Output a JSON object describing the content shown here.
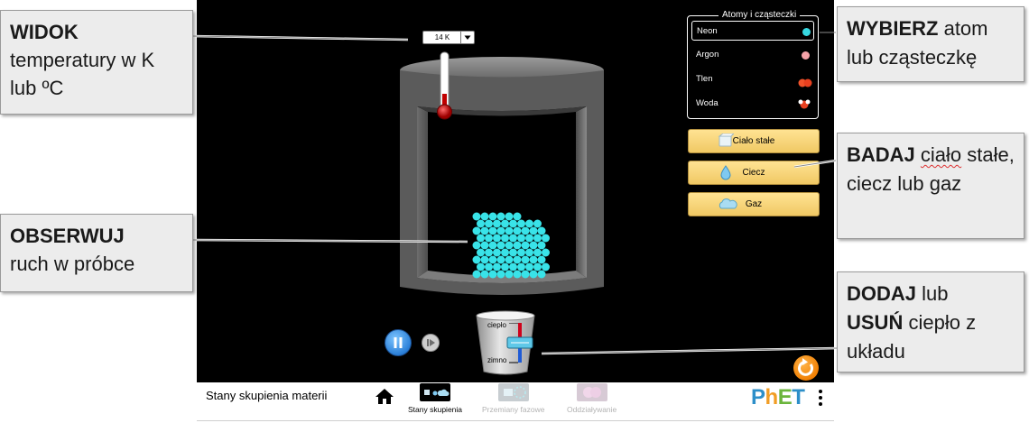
{
  "callouts": {
    "view": {
      "bold": "WIDOK",
      "text": "temperatury w K lub ºC"
    },
    "observe": {
      "bold": "OBSERWUJ",
      "text": "ruch w próbce"
    },
    "select": {
      "bold": "WYBIERZ",
      "text": "atom lub cząsteczkę"
    },
    "explore": {
      "bold": "BADAJ",
      "text": "ciało stałe, ciecz lub gaz"
    },
    "add": {
      "bold1": "DODAJ",
      "mid": "lub",
      "bold2": "USUŃ",
      "text": "ciepło z układu"
    }
  },
  "sim": {
    "atoms_panel": {
      "title": "Atomy i cząsteczki",
      "items": [
        {
          "label": "Neon",
          "color": "#36d7e0",
          "selected": true
        },
        {
          "label": "Argon",
          "color": "#f5a2a8",
          "selected": false
        },
        {
          "label": "Tlen",
          "color": "#f0522a",
          "selected": false
        },
        {
          "label": "Woda",
          "color": "#e8401f",
          "selected": false
        }
      ]
    },
    "phase_buttons": [
      {
        "label": "Ciało stałe",
        "icon": "ice-cube-icon"
      },
      {
        "label": "Ciecz",
        "icon": "water-drop-icon"
      },
      {
        "label": "Gaz",
        "icon": "cloud-icon"
      }
    ],
    "thermometer": {
      "value": "14 K"
    },
    "heater": {
      "hot_label": "ciepło",
      "cold_label": "zimno"
    },
    "particle_color": "#39e3e8"
  },
  "navbar": {
    "title": "Stany skupienia materii",
    "screens": [
      {
        "label": "Stany skupienia",
        "active": true
      },
      {
        "label": "Przemiany fazowe",
        "active": false
      },
      {
        "label": "Oddziaływanie",
        "active": false
      }
    ],
    "logo": "PhET"
  },
  "colors": {
    "background": "#000000",
    "phase_button": "#f5d67a",
    "pause_button": "#2a7fd8",
    "reset_button": "#f07d00"
  }
}
